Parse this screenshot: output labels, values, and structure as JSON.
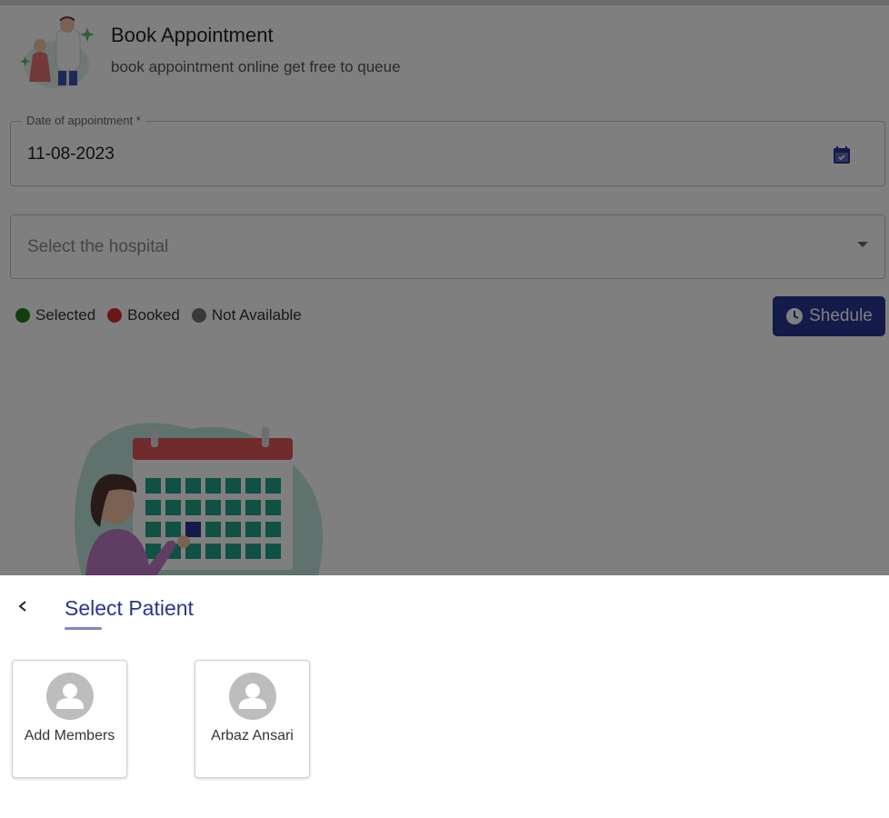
{
  "header": {
    "title": "Book Appointment",
    "subtitle": "book appointment online get free to queue"
  },
  "date_field": {
    "label": "Date of appointment *",
    "value": "11-08-2023",
    "icon": "calendar-icon"
  },
  "hospital_field": {
    "placeholder": "Select the hospital",
    "icon": "dropdown-arrow-icon"
  },
  "legend": [
    {
      "label": "Selected",
      "color": "#1e7b1e"
    },
    {
      "label": "Booked",
      "color": "#d32f2f"
    },
    {
      "label": "Not Available",
      "color": "#757575"
    }
  ],
  "schedule_button": {
    "label": "Shedule",
    "icon": "clock-icon",
    "color": "#283593"
  },
  "sheet": {
    "back_icon": "chevron-left-icon",
    "title": "Select Patient",
    "cards": [
      {
        "label": "Add Members",
        "icon": "person-avatar-icon"
      },
      {
        "label": "Arbaz Ansari",
        "icon": "person-avatar-icon"
      }
    ]
  },
  "colors": {
    "accent": "#283593",
    "overlay": "rgba(0,0,0,0.5)"
  }
}
